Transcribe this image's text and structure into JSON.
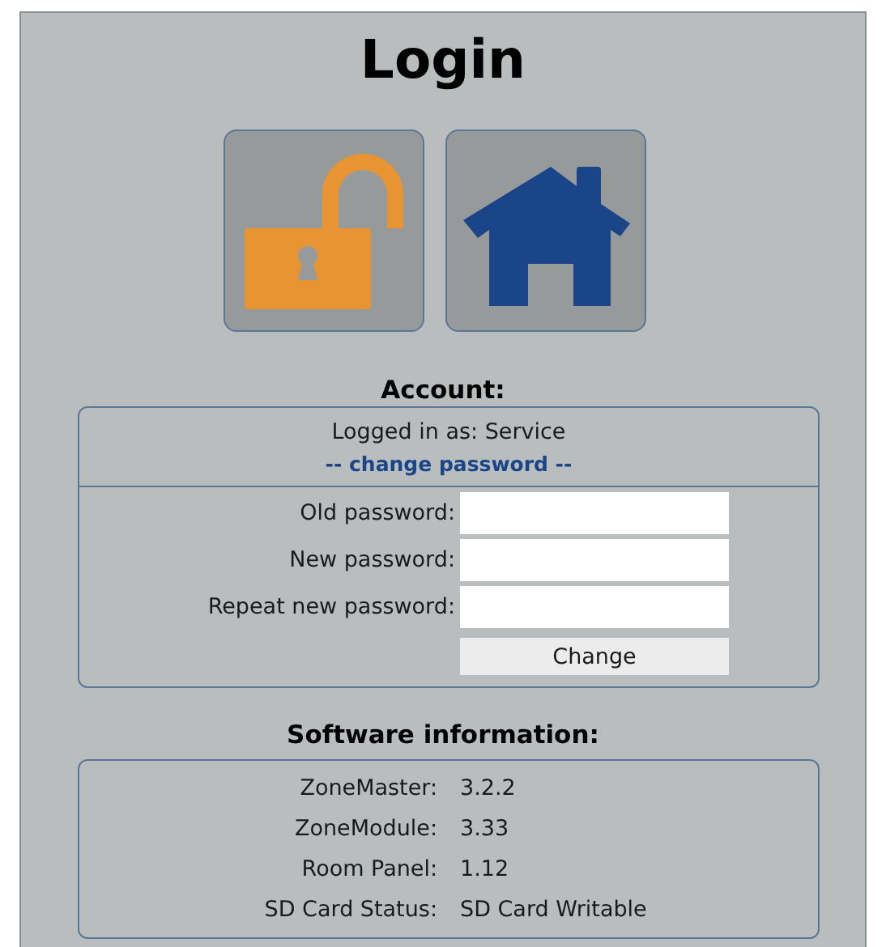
{
  "title": "Login",
  "tiles": [
    {
      "kind": "unlock"
    },
    {
      "kind": "home"
    }
  ],
  "account": {
    "heading": "Account:",
    "logged_in": "Logged in as: Service",
    "change_link": "-- change password --",
    "fields": [
      {
        "label": "Old password:"
      },
      {
        "label": "New password:"
      },
      {
        "label": "Repeat new password:"
      }
    ],
    "button": "Change"
  },
  "software": {
    "heading": "Software information:",
    "rows": [
      {
        "label": "ZoneMaster:",
        "value": "3.2.2"
      },
      {
        "label": "ZoneModule:",
        "value": "3.33"
      },
      {
        "label": "Room Panel:",
        "value": "1.12"
      },
      {
        "label": "SD Card Status:",
        "value": "SD Card Writable"
      }
    ]
  }
}
